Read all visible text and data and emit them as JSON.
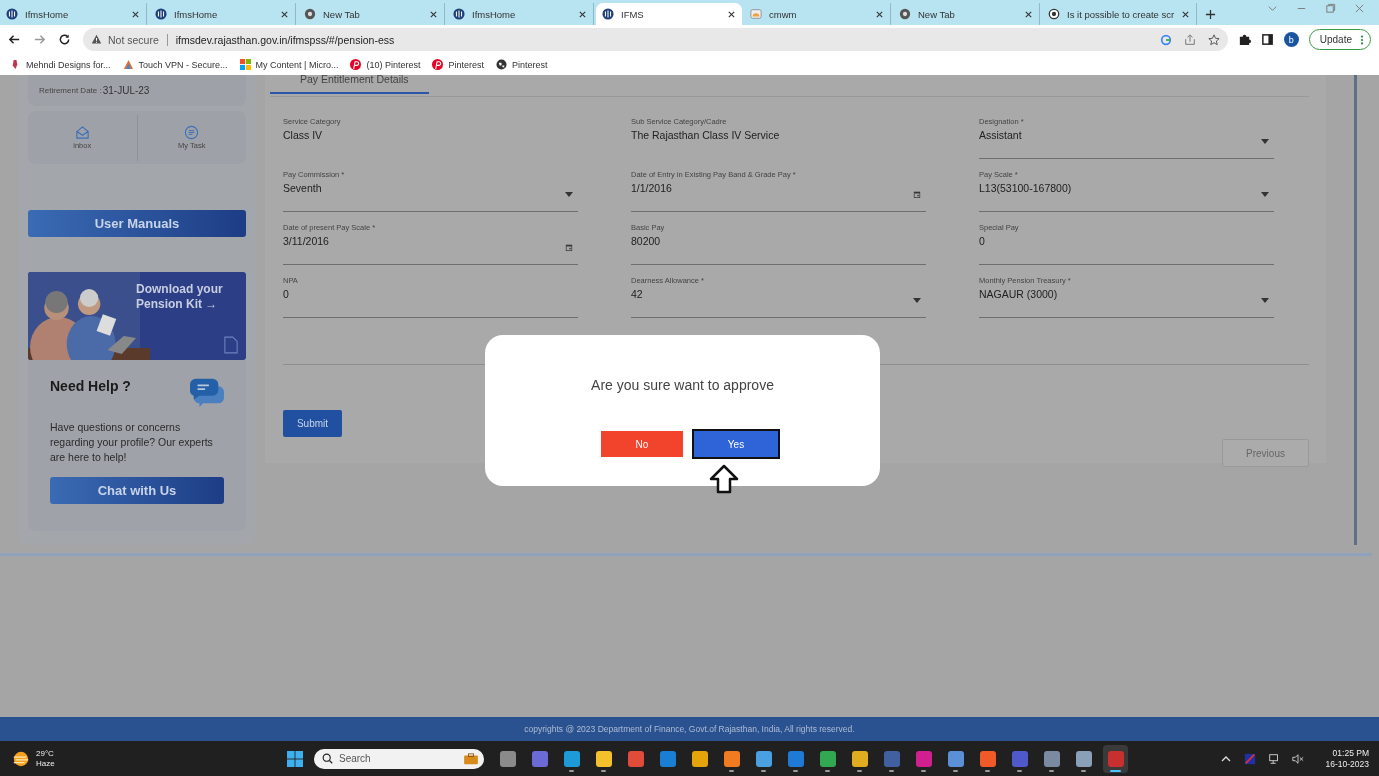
{
  "browser_tabs": [
    {
      "title": "IfmsHome",
      "kind": "ifms",
      "selected": false
    },
    {
      "title": "IfmsHome",
      "kind": "ifms",
      "selected": false
    },
    {
      "title": "New Tab",
      "kind": "globe",
      "selected": false
    },
    {
      "title": "IfmsHome",
      "kind": "ifms",
      "selected": false
    },
    {
      "title": "IFMS",
      "kind": "ifms",
      "selected": true
    },
    {
      "title": "cmwm",
      "kind": "page",
      "selected": false
    },
    {
      "title": "New Tab",
      "kind": "globe",
      "selected": false
    },
    {
      "title": "Is it possible to create scr",
      "kind": "ring",
      "selected": false
    }
  ],
  "address_bar": {
    "security": "Not secure",
    "url": "ifmsdev.rajasthan.gov.in/ifmspss/#/pension-ess"
  },
  "profile": {
    "initial": "b"
  },
  "update_button": "Update",
  "bookmarks": [
    {
      "label": "Mehndi Designs for...",
      "kind": "hand"
    },
    {
      "label": "Touch VPN - Secure...",
      "kind": "vpn"
    },
    {
      "label": "My Content | Micro...",
      "kind": "windows"
    },
    {
      "label": "(10) Pinterest",
      "kind": "pin"
    },
    {
      "label": "Pinterest",
      "kind": "pin"
    },
    {
      "label": "Pinterest",
      "kind": "globe"
    }
  ],
  "sidebar": {
    "retirement_label": "Retirement Date :",
    "retirement_date": "31-JUL-23",
    "quick_links": [
      {
        "label": "inbox",
        "kind": "mail"
      },
      {
        "label": "My Task",
        "kind": "list"
      }
    ],
    "manuals_button": "User Manuals",
    "promo": {
      "line1": "Download your",
      "line2": "Pension Kit →"
    },
    "help": {
      "title": "Need Help ?",
      "text": "Have questions or concerns regarding your profile? Our experts are here to help!",
      "button": "Chat with Us"
    }
  },
  "form": {
    "tab": "Pay Entitlement Details",
    "fields": [
      {
        "label": "Service Category",
        "value": "Class IV",
        "kind": "readonly"
      },
      {
        "label": "Sub Service Category/Cadre",
        "value": "The Rajasthan Class IV Service",
        "kind": "readonly"
      },
      {
        "label": "Designation *",
        "value": "Assistant",
        "kind": "select"
      },
      {
        "label": "Pay Commission *",
        "value": "Seventh",
        "kind": "select"
      },
      {
        "label": "Date of Entry in Existing Pay Band & Grade Pay *",
        "value": "1/1/2016",
        "kind": "date"
      },
      {
        "label": "Pay Scale *",
        "value": "L13(53100-167800)",
        "kind": "select"
      },
      {
        "label": "Date of present Pay Scale *",
        "value": "3/11/2016",
        "kind": "date"
      },
      {
        "label": "Basic Pay",
        "value": "80200",
        "kind": "input"
      },
      {
        "label": "Special Pay",
        "value": "0",
        "kind": "input"
      },
      {
        "label": "NPA",
        "value": "0",
        "kind": "input"
      },
      {
        "label": "Dearness Allowance *",
        "value": "42",
        "kind": "select"
      },
      {
        "label": "Monthly Pension Treasury *",
        "value": "NAGAUR (3000)",
        "kind": "select"
      }
    ],
    "submit": "Submit",
    "previous": "Previous"
  },
  "dialog": {
    "message": "Are you sure want to approve",
    "no": "No",
    "yes": "Yes"
  },
  "footer": "copyrights @ 2023 Department of Finance, Govt.of Rajasthan, India, All rights reserved.",
  "taskbar": {
    "weather_temp": "29°C",
    "weather_text": "Haze",
    "search": "Search",
    "apps": [
      {
        "running": false,
        "selected": false
      },
      {
        "running": false,
        "selected": false
      },
      {
        "running": true,
        "selected": false
      },
      {
        "running": true,
        "selected": false
      },
      {
        "running": false,
        "selected": false
      },
      {
        "running": false,
        "selected": false
      },
      {
        "running": false,
        "selected": false
      },
      {
        "running": true,
        "selected": false
      },
      {
        "running": true,
        "selected": false
      },
      {
        "running": true,
        "selected": false
      },
      {
        "running": true,
        "selected": false
      },
      {
        "running": true,
        "selected": false
      },
      {
        "running": true,
        "selected": false
      },
      {
        "running": true,
        "selected": false
      },
      {
        "running": true,
        "selected": false
      },
      {
        "running": true,
        "selected": false
      },
      {
        "running": true,
        "selected": false
      },
      {
        "running": true,
        "selected": false
      },
      {
        "running": true,
        "selected": false
      },
      {
        "running": true,
        "selected": true
      }
    ],
    "time": "01:25 PM",
    "date": "16-10-2023"
  }
}
